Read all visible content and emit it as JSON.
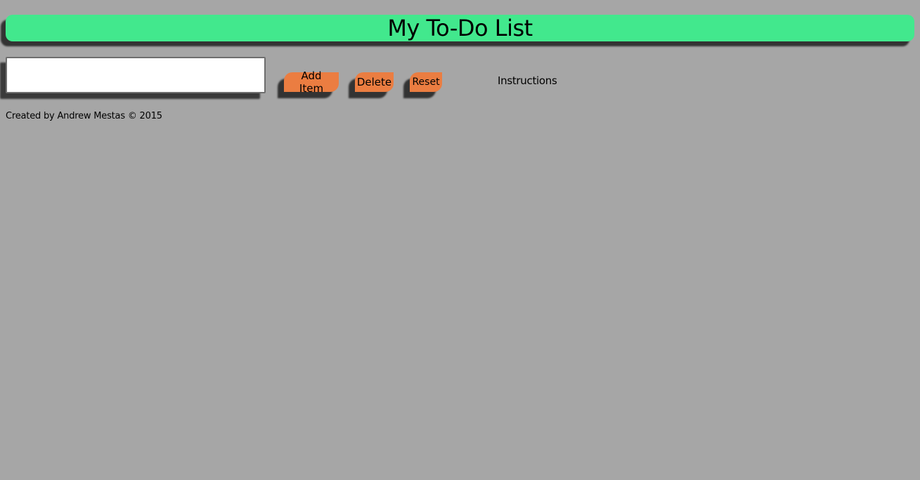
{
  "header": {
    "title": "My To-Do List"
  },
  "controls": {
    "input_value": "",
    "add_label": "Add Item",
    "delete_label": "Delete",
    "reset_label": "Reset",
    "instructions_label": "Instructions"
  },
  "footer": {
    "credit": "Created by Andrew Mestas © 2015"
  },
  "colors": {
    "background": "#a6a6a6",
    "header": "#42e88d",
    "button": "#eb7d41",
    "shadow": "#333333"
  }
}
